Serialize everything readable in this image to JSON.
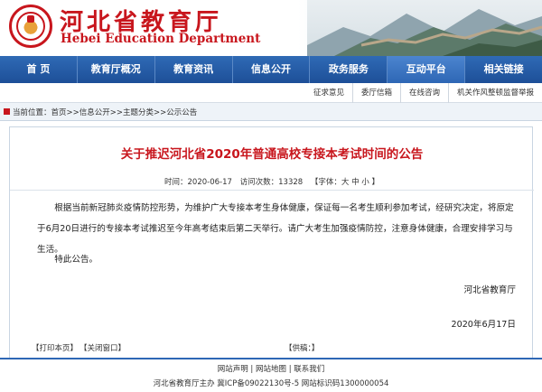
{
  "header": {
    "title": "河北省教育厅",
    "subtitle": "Hebei Education Department"
  },
  "nav": {
    "items": [
      {
        "label": "首 页"
      },
      {
        "label": "教育厅概况"
      },
      {
        "label": "教育资讯"
      },
      {
        "label": "信息公开"
      },
      {
        "label": "政务服务"
      },
      {
        "label": "互动平台"
      },
      {
        "label": "相关链接"
      }
    ],
    "active_index": 5
  },
  "subnav": {
    "items": [
      {
        "label": "征求意见"
      },
      {
        "label": "委厅信箱"
      },
      {
        "label": "在线咨询"
      },
      {
        "label": "机关作风整顿监督举报"
      }
    ]
  },
  "breadcrumb": {
    "text": "当前位置：首页>>信息公开>>主题分类>>公示公告"
  },
  "article": {
    "title": "关于推迟河北省2020年普通高校专接本考试时间的公告",
    "time": "时间：2020-06-17",
    "visits": "访问次数：13328",
    "font_size": "【字体：大 中 小 】",
    "paragraph1": "根据当前新冠肺炎疫情防控形势，为维护广大专接本考生身体健康，保证每一名考生顺利参加考试，经研究决定，将原定于6月20日进行的专接本考试推迟至今年高考结束后第二天举行。请广大考生加强疫情防控，注意身体健康，合理安排学习与生活。",
    "paragraph2": "特此公告。",
    "signature": "河北省教育厅",
    "date": "2020年6月17日"
  },
  "tools": {
    "print": "【打印本页】",
    "close": "【关闭窗口】",
    "source": "【供稿：】"
  },
  "footer": {
    "links": "网站声明 | 网站地图 | 联系我们",
    "info": "河北省教育厅主办 冀ICP备09022130号-5 网站标识码1300000054"
  },
  "colors": {
    "brand_red": "#c8161d",
    "nav_blue": "#1d4f98"
  }
}
